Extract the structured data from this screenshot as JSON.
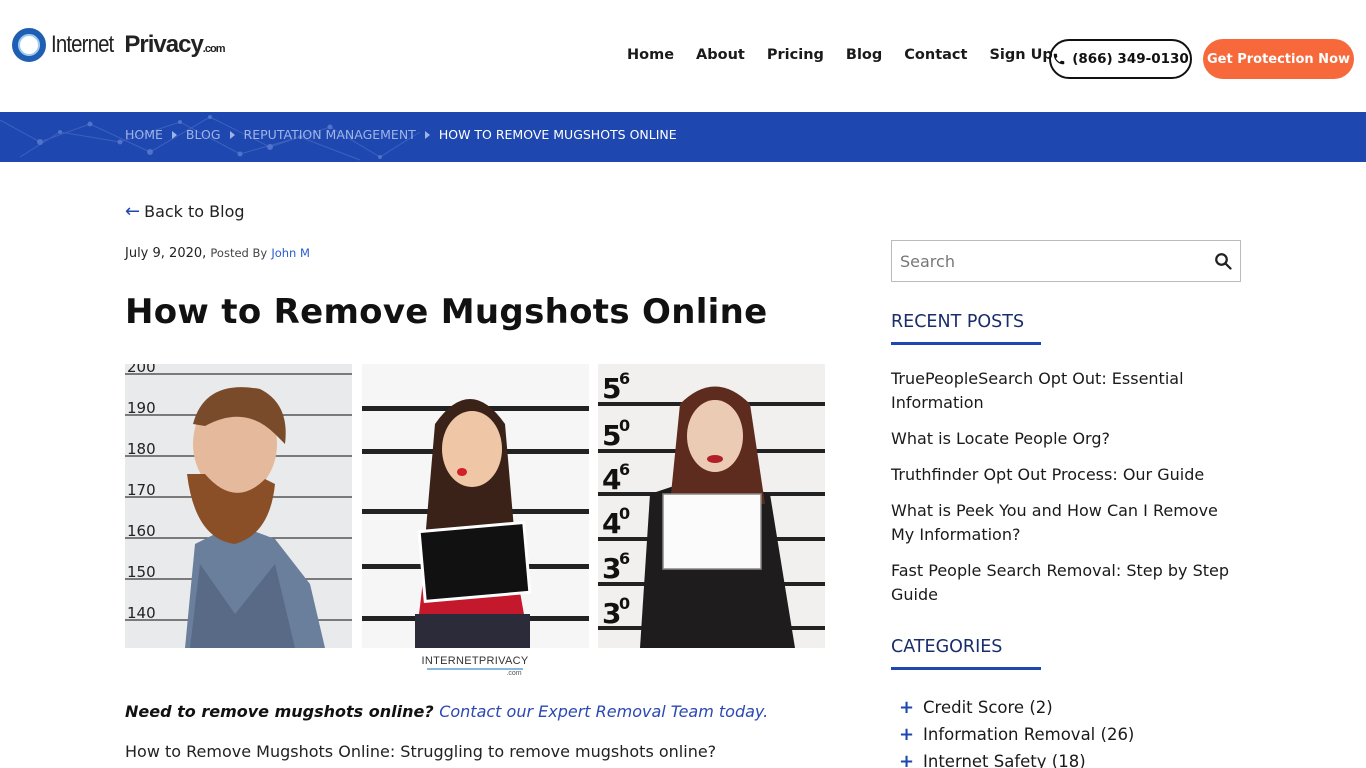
{
  "logo": {
    "internet": "Internet",
    "privacy": "Privacy",
    "com": ".com"
  },
  "nav": {
    "items": [
      "Home",
      "About",
      "Pricing",
      "Blog",
      "Contact",
      "Sign Up"
    ]
  },
  "phone": "(866) 349-0130",
  "cta": "Get Protection Now",
  "breadcrumb": {
    "home": "HOME",
    "blog": "BLOG",
    "category": "REPUTATION MANAGEMENT",
    "current": "HOW TO REMOVE MUGSHOTS ONLINE"
  },
  "back": "Back to Blog",
  "meta": {
    "date": "July 9, 2020,",
    "posted_by": "Posted By",
    "author": "John M"
  },
  "title": "How to Remove Mugshots Online",
  "hero": {
    "ruler_left": [
      "200",
      "190",
      "180",
      "170",
      "160",
      "150",
      "140"
    ],
    "ruler_right": [
      "5",
      "6",
      "5",
      "0",
      "4",
      "6",
      "4",
      "0",
      "3",
      "6",
      "3",
      "0"
    ],
    "watermark_main": "INTERNETPRIVACY",
    "watermark_com": ".com"
  },
  "intro": {
    "lead": "Need to remove mugshots online?",
    "link": "Contact our Expert Removal Team today."
  },
  "body": "How to Remove Mugshots Online: Struggling to remove mugshots online?",
  "sidebar": {
    "search_placeholder": "Search",
    "recent_title": "RECENT POSTS",
    "recent": [
      "TruePeopleSearch Opt Out: Essential Information",
      "What is Locate People Org?",
      "Truthfinder Opt Out Process: Our Guide",
      "What is Peek You and How Can I Remove My Information?",
      "Fast People Search Removal: Step by Step Guide"
    ],
    "categories_title": "CATEGORIES",
    "categories": [
      "Credit Score (2)",
      "Information Removal (26)",
      "Internet Safety (18)"
    ]
  },
  "colors": {
    "brand_blue": "#1f47b0",
    "cta_orange": "#f7683a"
  }
}
